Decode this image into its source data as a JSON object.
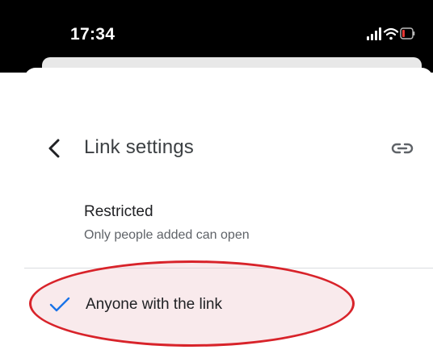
{
  "status_bar": {
    "time": "17:34",
    "icons": [
      "signal-icon",
      "wifi-icon",
      "battery-low-icon"
    ]
  },
  "header": {
    "title": "Link settings",
    "back_icon": "chevron-left-icon",
    "action_icon": "link-icon"
  },
  "options": {
    "restricted": {
      "title": "Restricted",
      "subtitle": "Only people added can open",
      "selected": false
    },
    "anyone": {
      "title": "Anyone with the link",
      "selected": true
    }
  },
  "colors": {
    "status_bar_bg": "#000000",
    "accent": "#1a73e8",
    "battery_low": "#e53935",
    "highlight_outline": "#d8232a",
    "divider": "#dadce0"
  }
}
